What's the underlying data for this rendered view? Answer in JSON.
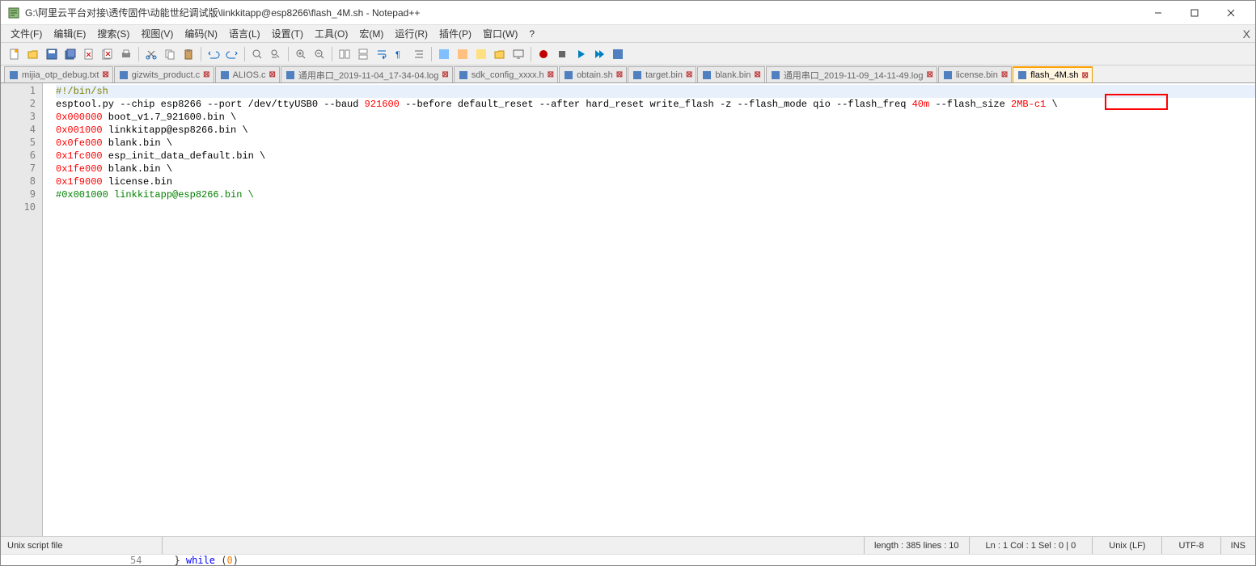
{
  "title": "G:\\阿里云平台对接\\透传固件\\动能世纪调试版\\linkkitapp@esp8266\\flash_4M.sh - Notepad++",
  "menus": [
    "文件(F)",
    "编辑(E)",
    "搜索(S)",
    "视图(V)",
    "编码(N)",
    "语言(L)",
    "设置(T)",
    "工具(O)",
    "宏(M)",
    "运行(R)",
    "插件(P)",
    "窗口(W)",
    "?"
  ],
  "tabs": [
    {
      "label": "mijia_otp_debug.txt",
      "active": false
    },
    {
      "label": "gizwits_product.c",
      "active": false
    },
    {
      "label": "ALIOS.c",
      "active": false
    },
    {
      "label": "通用串口_2019-11-04_17-34-04.log",
      "active": false
    },
    {
      "label": "sdk_config_xxxx.h",
      "active": false
    },
    {
      "label": "obtain.sh",
      "active": false
    },
    {
      "label": "target.bin",
      "active": false
    },
    {
      "label": "blank.bin",
      "active": false
    },
    {
      "label": "通用串口_2019-11-09_14-11-49.log",
      "active": false
    },
    {
      "label": "license.bin",
      "active": false
    },
    {
      "label": "flash_4M.sh",
      "active": true
    }
  ],
  "code": {
    "l1": "#!/bin/sh",
    "l2a": "esptool.py --chip esp8266 --port /dev/ttyUSB0 --baud ",
    "l2b": "921600",
    "l2c": " --before default_reset --after hard_reset write_flash -z --flash_mode qio --flash_freq ",
    "l2d": "40m",
    "l2e": " --flash_size ",
    "l2f": "2MB-c1",
    "l2g": " \\",
    "l3a": "0x000000",
    "l3b": " boot_v1.7_921600.bin \\",
    "l4a": "0x001000",
    "l4b": " linkkitapp@esp8266.bin \\",
    "l5a": "0x0fe000",
    "l5b": " blank.bin \\",
    "l6a": "0x1fc000",
    "l6b": " esp_init_data_default.bin \\",
    "l7a": "0x1fe000",
    "l7b": " blank.bin \\",
    "l8a": "0x1f9000",
    "l8b": " license.bin",
    "l9": "#0x001000 linkkitapp@esp8266.bin \\"
  },
  "line_numbers": [
    "1",
    "2",
    "3",
    "4",
    "5",
    "6",
    "7",
    "8",
    "9",
    "10"
  ],
  "status": {
    "filetype": "Unix script file",
    "length": "length : 385    lines : 10",
    "pos": "Ln : 1    Col : 1    Sel : 0 | 0",
    "eol": "Unix (LF)",
    "encoding": "UTF-8",
    "mode": "INS"
  },
  "fragment_a": "} ",
  "fragment_b": "while",
  "fragment_c": " (",
  "fragment_d": "0",
  "fragment_e": ")",
  "fragment_ln": "54"
}
